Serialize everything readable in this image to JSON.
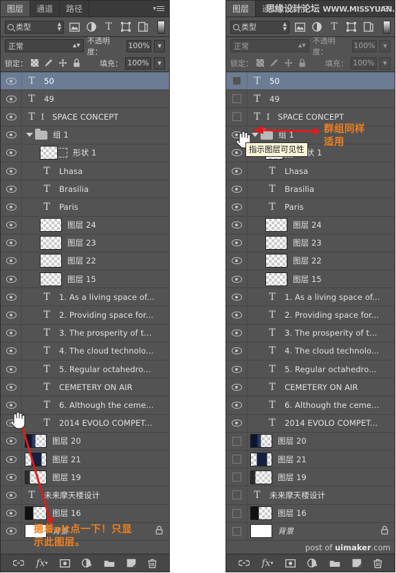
{
  "app": "Adobe Photoshop",
  "panel": {
    "tabs": [
      "图层",
      "通道",
      "路径"
    ],
    "active_tab": "图层",
    "menu_icon": "panel-menu-icon",
    "filter": {
      "kind_label": "类型",
      "search_icon": "search-icon",
      "buttons": [
        "pixel-filter-icon",
        "adjustment-filter-icon",
        "type-filter-icon",
        "shape-filter-icon",
        "smartobject-filter-icon"
      ],
      "toggle_swatch": "filter-toggle-swatch"
    },
    "blend": {
      "mode": "正常",
      "opacity_label": "不透明度：",
      "opacity_value": "100%"
    },
    "lock": {
      "label": "锁定：",
      "icons": [
        "lock-transparency-icon",
        "lock-image-icon",
        "lock-position-icon",
        "lock-all-icon"
      ],
      "fill_label": "填充：",
      "fill_value": "100%"
    },
    "bottom_toolbar": [
      {
        "name": "link-layers-icon",
        "glyph": "∞"
      },
      {
        "name": "layer-style-fx-icon",
        "glyph": "fx"
      },
      {
        "name": "add-layer-mask-icon",
        "glyph": "■"
      },
      {
        "name": "new-fill-adjustment-icon",
        "glyph": "◑"
      },
      {
        "name": "new-group-icon",
        "glyph": "▬"
      },
      {
        "name": "new-layer-icon",
        "glyph": "◥"
      },
      {
        "name": "delete-layer-icon",
        "glyph": "Ὕ1"
      }
    ]
  },
  "layers": [
    {
      "name": "50",
      "type": "text",
      "indent": 0,
      "selected": true,
      "visible_left": true,
      "visible_right": false
    },
    {
      "name": "49",
      "type": "text",
      "indent": 0,
      "selected": false,
      "visible_left": true,
      "visible_right": false
    },
    {
      "name": "SPACE CONCEPT",
      "type": "text-italic",
      "indent": 0,
      "selected": false,
      "visible_left": true,
      "visible_right": false
    },
    {
      "name": "组 1",
      "type": "group",
      "indent": 0,
      "selected": false,
      "visible_left": true,
      "visible_right": true
    },
    {
      "name": "形状 1",
      "type": "shape",
      "indent": 1,
      "selected": false,
      "visible_left": true,
      "visible_right": true
    },
    {
      "name": "Lhasa",
      "type": "text",
      "indent": 1,
      "selected": false,
      "visible_left": true,
      "visible_right": true
    },
    {
      "name": "Brasilia",
      "type": "text",
      "indent": 1,
      "selected": false,
      "visible_left": true,
      "visible_right": true
    },
    {
      "name": "Paris",
      "type": "text",
      "indent": 1,
      "selected": false,
      "visible_left": true,
      "visible_right": true
    },
    {
      "name": "图层 24",
      "type": "pixel",
      "indent": 1,
      "selected": false,
      "visible_left": true,
      "visible_right": true
    },
    {
      "name": "图层 23",
      "type": "pixel",
      "indent": 1,
      "selected": false,
      "visible_left": true,
      "visible_right": true
    },
    {
      "name": "图层 22",
      "type": "pixel",
      "indent": 1,
      "selected": false,
      "visible_left": true,
      "visible_right": true
    },
    {
      "name": "图层 15",
      "type": "pixel",
      "indent": 1,
      "selected": false,
      "visible_left": true,
      "visible_right": true
    },
    {
      "name": "1. As a living space of...",
      "type": "text",
      "indent": 1,
      "selected": false,
      "visible_left": true,
      "visible_right": true
    },
    {
      "name": "2. Providing space for...",
      "type": "text",
      "indent": 1,
      "selected": false,
      "visible_left": true,
      "visible_right": true
    },
    {
      "name": "3. The prosperity of t...",
      "type": "text",
      "indent": 1,
      "selected": false,
      "visible_left": true,
      "visible_right": true
    },
    {
      "name": "4. The cloud technolo...",
      "type": "text",
      "indent": 1,
      "selected": false,
      "visible_left": true,
      "visible_right": true
    },
    {
      "name": "5. Regular octahedro...",
      "type": "text",
      "indent": 1,
      "selected": false,
      "visible_left": true,
      "visible_right": true
    },
    {
      "name": "CEMETERY ON AIR",
      "type": "text",
      "indent": 1,
      "selected": false,
      "visible_left": true,
      "visible_right": true
    },
    {
      "name": "6. Although the ceme...",
      "type": "text",
      "indent": 1,
      "selected": false,
      "visible_left": true,
      "visible_right": true
    },
    {
      "name": "2014 EVOLO COMPET...",
      "type": "text",
      "indent": 1,
      "selected": false,
      "visible_left": true,
      "visible_right": true
    },
    {
      "name": "图层 20",
      "type": "pixel-art-20",
      "indent": 0,
      "selected": false,
      "visible_left": true,
      "visible_right": false
    },
    {
      "name": "图层 21",
      "type": "pixel-art-21",
      "indent": 0,
      "selected": false,
      "visible_left": true,
      "visible_right": false
    },
    {
      "name": "图层 19",
      "type": "pixel-art-19",
      "indent": 0,
      "selected": false,
      "visible_left": true,
      "visible_right": false
    },
    {
      "name": "未来摩天楼设计",
      "type": "text",
      "indent": 0,
      "selected": false,
      "visible_left": true,
      "visible_right": false
    },
    {
      "name": "图层 16",
      "type": "pixel-art-16",
      "indent": 0,
      "selected": false,
      "visible_left": true,
      "visible_right": false
    },
    {
      "name": "背景",
      "type": "background",
      "indent": 0,
      "selected": false,
      "visible_left": true,
      "visible_right": false,
      "locked": true,
      "lock_icon": "lock-icon"
    }
  ],
  "annotations": {
    "left_note": "摁着alt点一下！只显\n示此图层。",
    "left_arrow": "red-arrow-pointing-to-eye-icon",
    "left_cursor": "hand-cursor",
    "right_note": "群组同样\n适用",
    "right_arrow": "red-arrow-pointing-to-group-eye-icon",
    "right_cursor": "hand-cursor",
    "tooltip": "指示图层可见性"
  },
  "watermarks": {
    "top": "思缘设计论坛",
    "top_url": "WWW.MISSYUAN.COM",
    "bottom_prefix": "post of ",
    "bottom_brand": "uimaker",
    "bottom_suffix": ".com"
  }
}
